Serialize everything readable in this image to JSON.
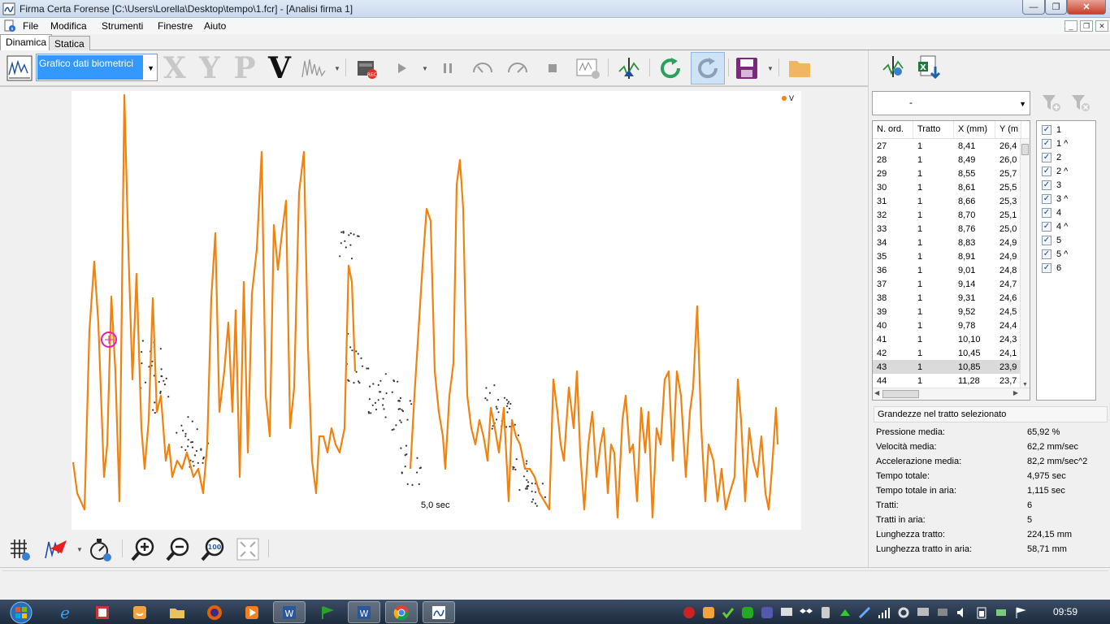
{
  "window": {
    "title": "Firma Certa Forense [C:\\Users\\Lorella\\Desktop\\tempo\\1.fcr] - [Analisi firma 1]",
    "minimize_label": "—",
    "restore_label": "❐",
    "close_label": "✕"
  },
  "menu": {
    "file": "File",
    "modifica": "Modifica",
    "strumenti": "Strumenti",
    "finestre": "Finestre",
    "aiuto": "Aiuto"
  },
  "tabs": [
    {
      "label": "Dinamica",
      "active": true
    },
    {
      "label": "Statica",
      "active": false
    }
  ],
  "toolbar": {
    "chart_selector_value": "Grafico dati biometrici",
    "letters": [
      "X",
      "Y",
      "P",
      "V"
    ],
    "active_letter": "V"
  },
  "chart": {
    "legend_label": "V",
    "time_label": "5,0 sec",
    "line_color": "#f0820f",
    "dot_color": "#333333"
  },
  "right_panel": {
    "combo_value": "-",
    "table_headers": [
      "N. ord.",
      "Tratto",
      "X (mm)",
      "Y (m"
    ],
    "rows": [
      [
        "27",
        "1",
        "8,41",
        "26,4"
      ],
      [
        "28",
        "1",
        "8,49",
        "26,0"
      ],
      [
        "29",
        "1",
        "8,55",
        "25,7"
      ],
      [
        "30",
        "1",
        "8,61",
        "25,5"
      ],
      [
        "31",
        "1",
        "8,66",
        "25,3"
      ],
      [
        "32",
        "1",
        "8,70",
        "25,1"
      ],
      [
        "33",
        "1",
        "8,76",
        "25,0"
      ],
      [
        "34",
        "1",
        "8,83",
        "24,9"
      ],
      [
        "35",
        "1",
        "8,91",
        "24,9"
      ],
      [
        "36",
        "1",
        "9,01",
        "24,8"
      ],
      [
        "37",
        "1",
        "9,14",
        "24,7"
      ],
      [
        "38",
        "1",
        "9,31",
        "24,6"
      ],
      [
        "39",
        "1",
        "9,52",
        "24,5"
      ],
      [
        "40",
        "1",
        "9,78",
        "24,4"
      ],
      [
        "41",
        "1",
        "10,10",
        "24,3"
      ],
      [
        "42",
        "1",
        "10,45",
        "24,1"
      ],
      [
        "43",
        "1",
        "10,85",
        "23,9"
      ],
      [
        "44",
        "1",
        "11,28",
        "23,7"
      ]
    ],
    "selected_row": 16,
    "strokes": [
      "1",
      "1 ^",
      "2",
      "2 ^",
      "3",
      "3 ^",
      "4",
      "4 ^",
      "5",
      "5 ^",
      "6"
    ],
    "stats_header": "Grandezze nel tratto selezionato",
    "stats": [
      {
        "label": "Pressione media:",
        "value": "65,92 %"
      },
      {
        "label": "Velocità media:",
        "value": "62,2 mm/sec"
      },
      {
        "label": "Accelerazione media:",
        "value": "82,2 mm/sec^2"
      },
      {
        "label": "Tempo totale:",
        "value": "4,975 sec"
      },
      {
        "label": "Tempo totale in aria:",
        "value": "1,115 sec"
      },
      {
        "label": "Tratti:",
        "value": "6"
      },
      {
        "label": "Tratti in aria:",
        "value": "5"
      },
      {
        "label": "Lunghezza tratto:",
        "value": "224,15 mm"
      },
      {
        "label": "Lunghezza tratto in aria:",
        "value": "58,71 mm"
      }
    ]
  },
  "taskbar": {
    "clock": "09:59"
  }
}
